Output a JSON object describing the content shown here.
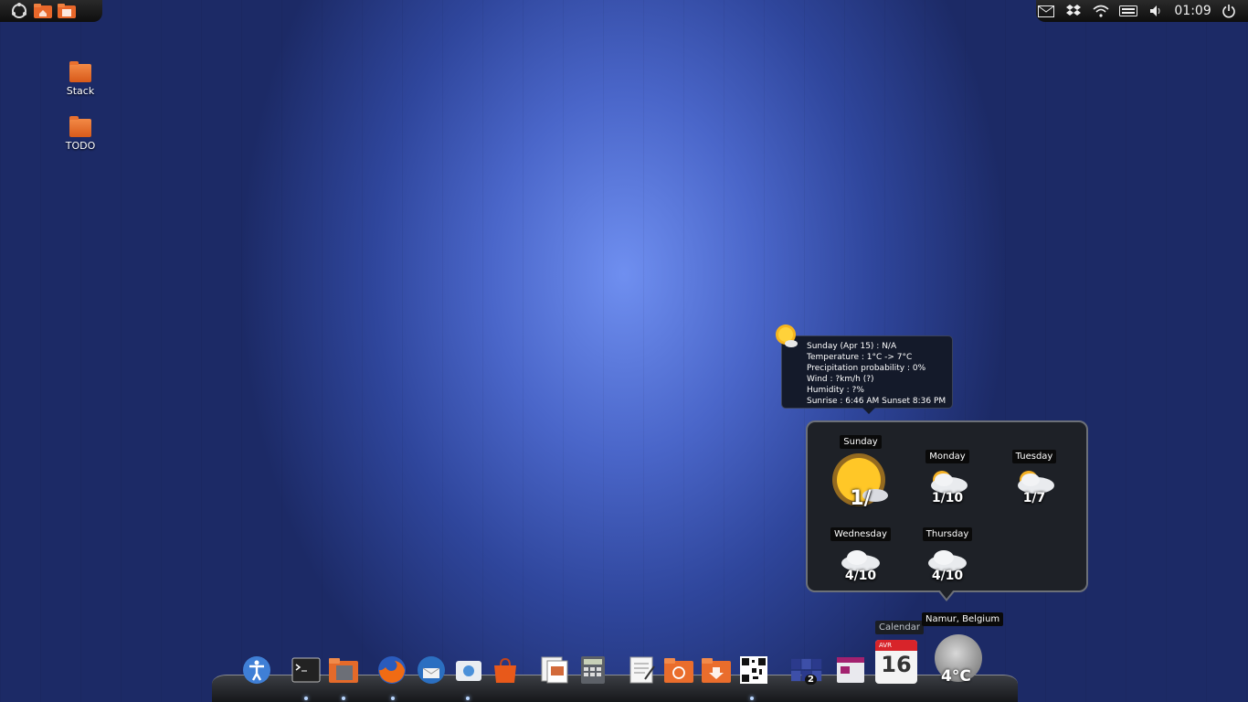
{
  "topbar": {
    "left_icons": [
      "ubuntu-menu-icon",
      "home-folder-icon",
      "files-icon"
    ],
    "right_icons": [
      "mail-icon",
      "dropbox-icon",
      "wifi-icon",
      "keyboard-icon",
      "volume-icon"
    ],
    "clock": "01:09",
    "power_icon": "power-icon"
  },
  "desktop": {
    "icons": [
      {
        "label": "Stack",
        "icon": "folder-icon"
      },
      {
        "label": "TODO",
        "icon": "folder-icon"
      }
    ]
  },
  "tooltip": {
    "lines": [
      "Sunday (Apr 15) : N/A",
      "Temperature : 1°C -> 7°C",
      "Precipitation probability : 0%",
      "Wind : ?km/h (?)",
      "Humidity : ?%",
      "Sunrise : 6:46 AM  Sunset 8:36 PM"
    ]
  },
  "weather": {
    "location": "Namur, Belgium",
    "days": [
      {
        "name": "Sunday",
        "temp": "1/",
        "icon": "sun-cloud-icon"
      },
      {
        "name": "Monday",
        "temp": "1/10",
        "icon": "sun-snow-cloud-icon"
      },
      {
        "name": "Tuesday",
        "temp": "1/7",
        "icon": "sun-snow-cloud-icon"
      },
      {
        "name": "Wednesday",
        "temp": "4/10",
        "icon": "snow-cloud-icon"
      },
      {
        "name": "Thursday",
        "temp": "4/10",
        "icon": "snow-cloud-icon"
      }
    ],
    "current_temp": "4°C"
  },
  "dock": {
    "calendar_label": "Calendar",
    "calendar_month": "AVR",
    "calendar_day": "16",
    "items": [
      "accessibility-icon",
      "terminal-icon",
      "folder-stack-icon",
      "firefox-icon",
      "thunderbird-icon",
      "screenshot-icon",
      "software-center-icon",
      "documents-icon",
      "calculator-icon",
      "text-editor-icon",
      "backup-folder-icon",
      "downloads-folder-icon",
      "qr-icon",
      "workspaces-icon",
      "window-icon"
    ],
    "workspace_number": "2"
  }
}
